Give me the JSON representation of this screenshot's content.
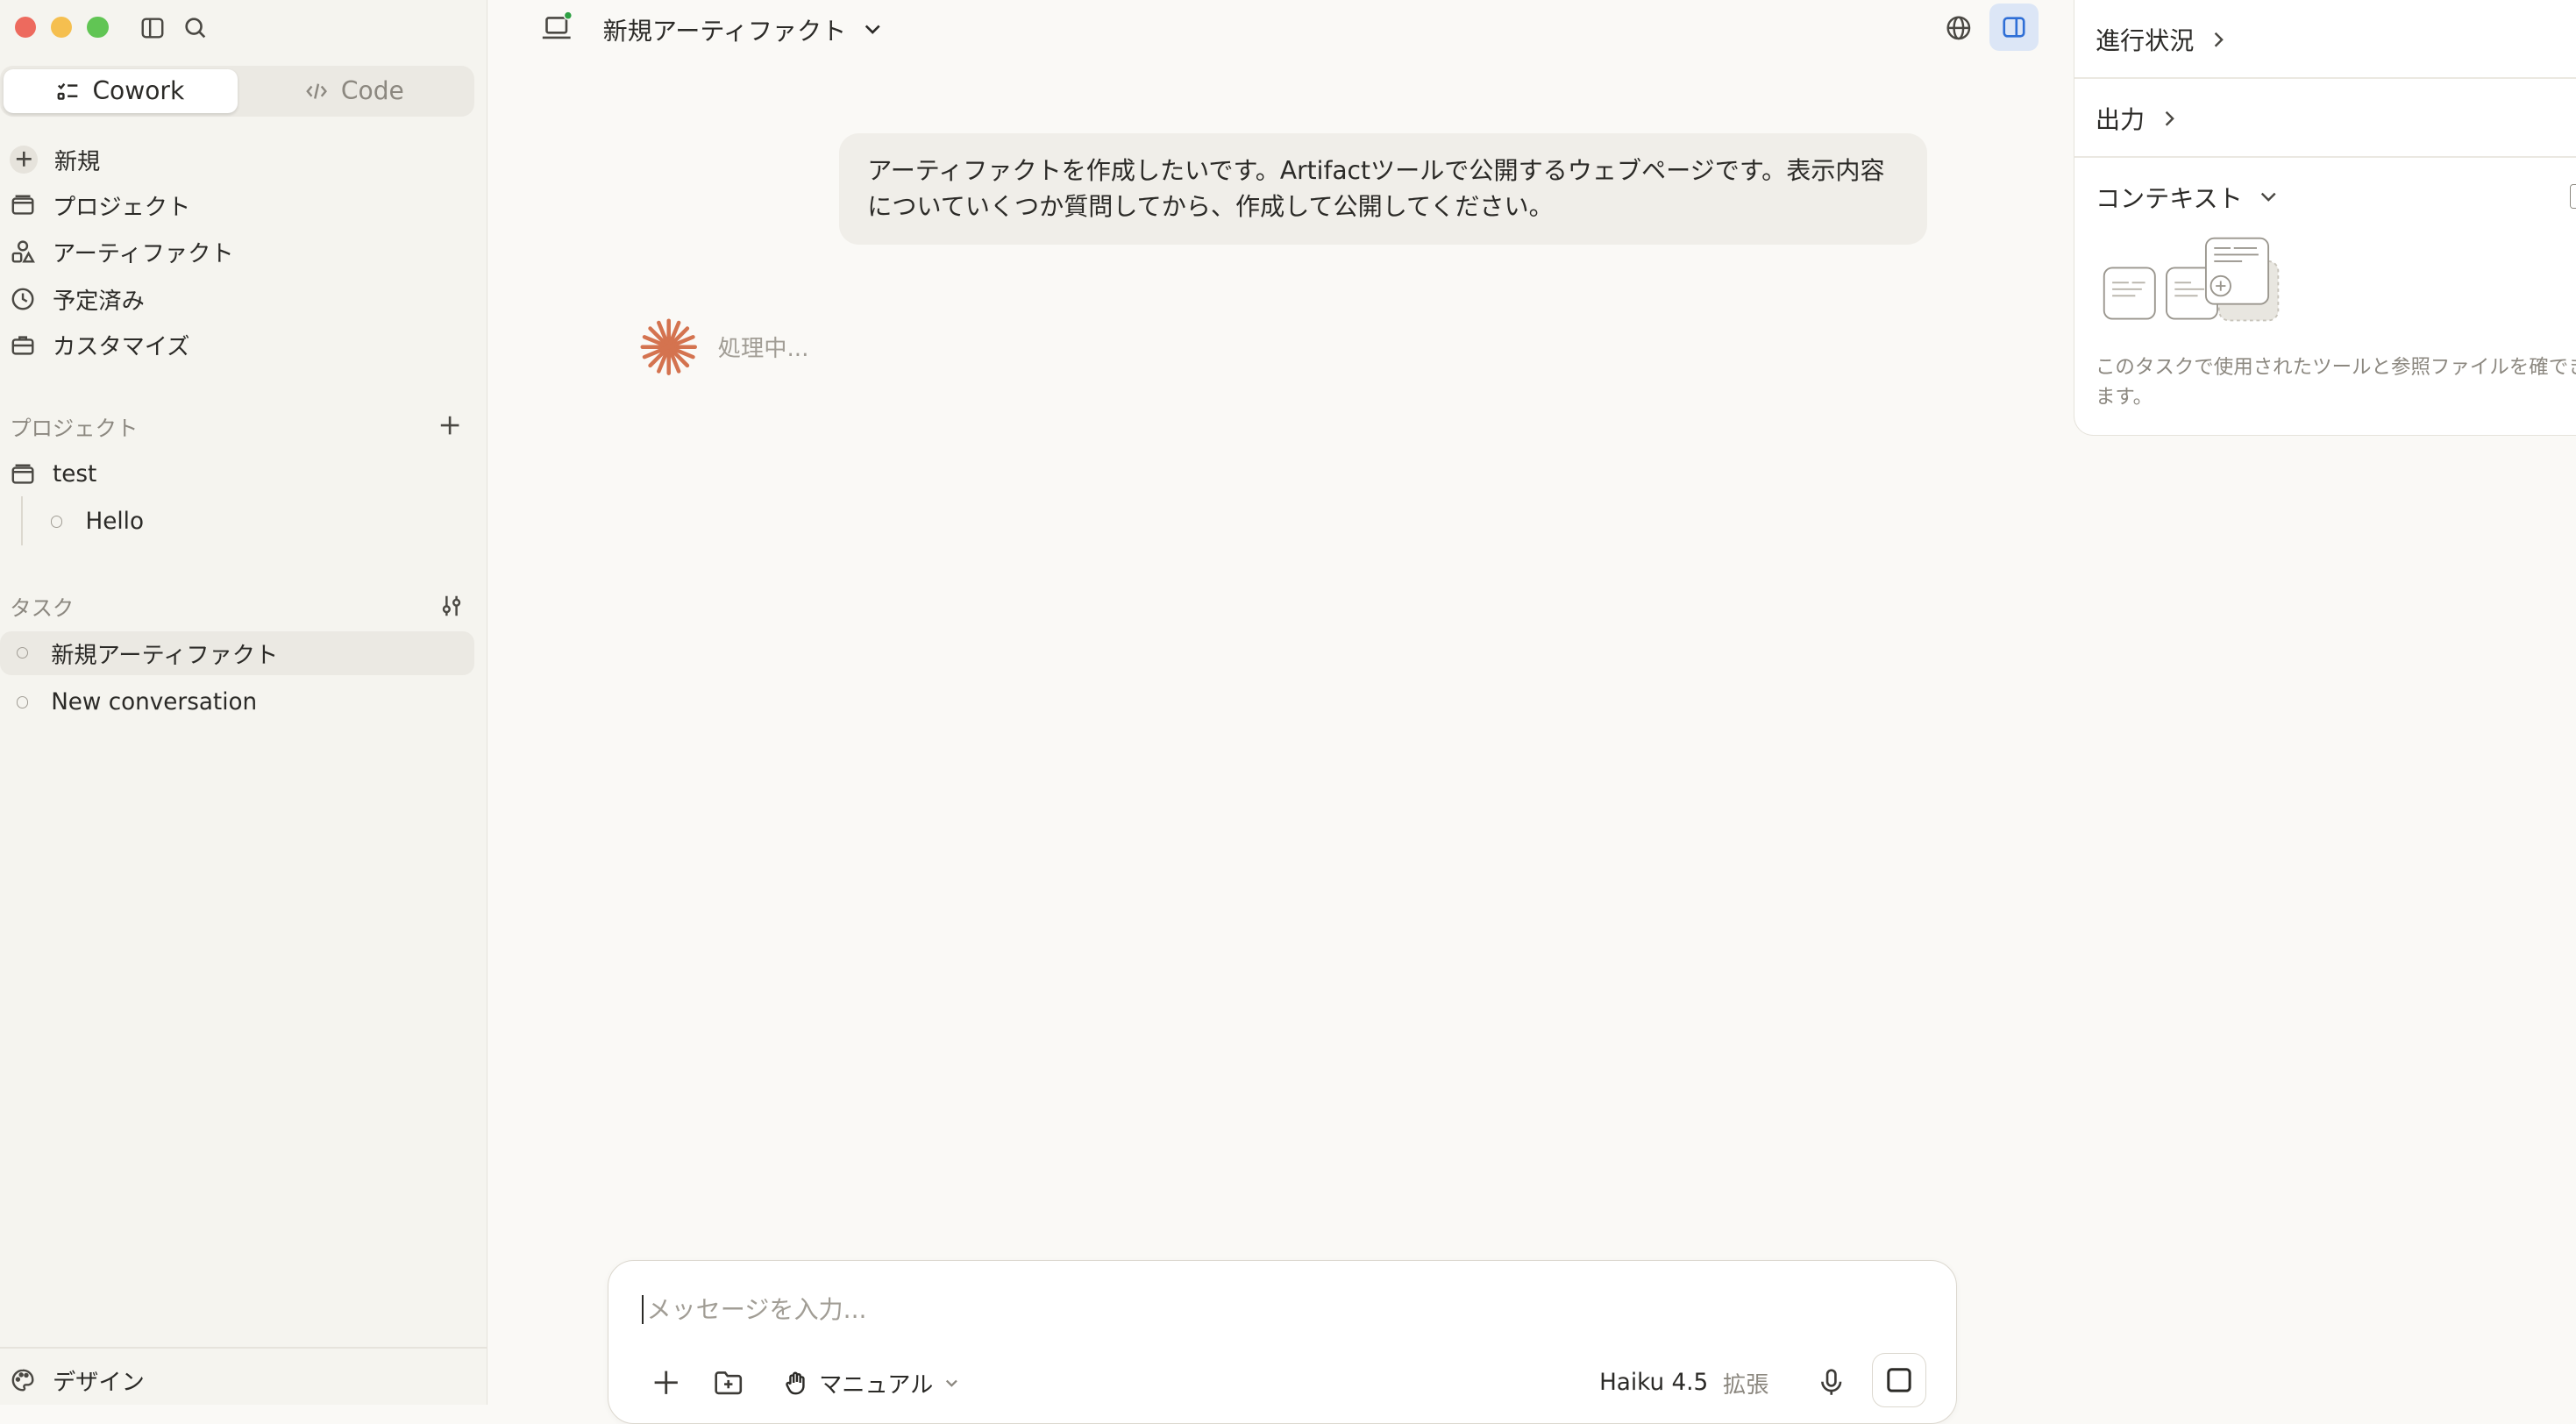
{
  "sidebar": {
    "modes": [
      {
        "label": "Cowork",
        "active": true
      },
      {
        "label": "Code",
        "active": false
      }
    ],
    "nav": [
      {
        "label": "新規",
        "icon": "plus-icon"
      },
      {
        "label": "プロジェクト",
        "icon": "folder-icon"
      },
      {
        "label": "アーティファクト",
        "icon": "shapes-icon"
      },
      {
        "label": "予定済み",
        "icon": "clock-icon"
      },
      {
        "label": "カスタマイズ",
        "icon": "briefcase-icon"
      }
    ],
    "projects_label": "プロジェクト",
    "projects": [
      {
        "label": "test",
        "children": [
          {
            "label": "Hello"
          }
        ]
      }
    ],
    "tasks_label": "タスク",
    "tasks": [
      {
        "label": "新規アーティファクト",
        "active": true
      },
      {
        "label": "New conversation",
        "active": false
      }
    ],
    "footer_label": "デザイン"
  },
  "header": {
    "title": "新規アーティファクト"
  },
  "conversation": {
    "user_message": "アーティファクトを作成したいです。Artifactツールで公開するウェブページです。表示内容についていくつか質問してから、作成して公開してください。",
    "status": "処理中..."
  },
  "composer": {
    "placeholder": "メッセージを入力...",
    "mode": "マニュアル",
    "model": "Haiku 4.5",
    "model_option": "拡張"
  },
  "right_panel": {
    "progress_label": "進行状況",
    "output_label": "出力",
    "context_label": "コンテキスト",
    "context_desc": "このタスクで使用されたツールと参照ファイルを確できます。"
  },
  "colors": {
    "accent": "#2f6fd6",
    "spinner": "#d4734f",
    "status_dot": "#2ea043"
  }
}
